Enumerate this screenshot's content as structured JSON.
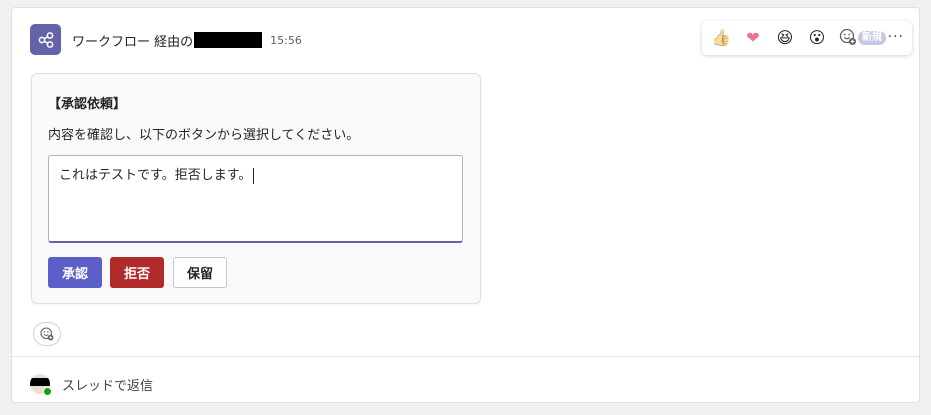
{
  "message": {
    "sender_prefix": "ワークフロー 経由の",
    "time": "15:56"
  },
  "reactions": {
    "items": [
      {
        "name": "like",
        "glyph": "👍"
      },
      {
        "name": "heart",
        "glyph": "❤"
      },
      {
        "name": "laugh",
        "glyph": "😆"
      },
      {
        "name": "surprised",
        "glyph": "😮"
      }
    ],
    "new_badge": "新規",
    "more": "···"
  },
  "card": {
    "title": "【承認依頼】",
    "body": "内容を確認し、以下のボタンから選択してください。",
    "input_value": "これはテストです。拒否します。",
    "buttons": {
      "approve": "承認",
      "reject": "拒否",
      "hold": "保留"
    }
  },
  "reply": {
    "label": "スレッドで返信"
  },
  "colors": {
    "accent": "#6264a7",
    "approve": "#5b5fc7",
    "reject": "#b12b2b"
  }
}
